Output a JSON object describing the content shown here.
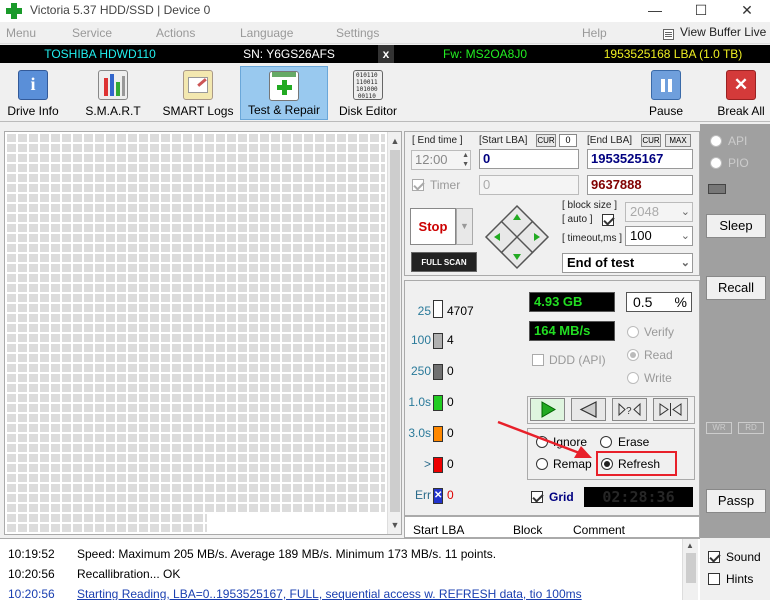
{
  "window": {
    "title": "Victoria 5.37 HDD/SSD | Device 0",
    "minimize": "—",
    "maximize": "☐",
    "close": "✕"
  },
  "menu": {
    "items": [
      "Menu",
      "Service",
      "Actions",
      "Language",
      "Settings",
      "Help"
    ],
    "view_buffer_live": "View Buffer Live"
  },
  "drive": {
    "model": "TOSHIBA HDWD110",
    "serial": "SN: Y6GS26AFS",
    "close": "x",
    "firmware": "Fw: MS2OA8J0",
    "lba": "1953525168 LBA (1.0 TB)"
  },
  "toolbar": {
    "drive_info": "Drive Info",
    "smart": "S.M.A.R.T",
    "smart_logs": "SMART Logs",
    "test_repair": "Test & Repair",
    "disk_editor": "Disk Editor",
    "pause": "Pause",
    "break_all": "Break All",
    "disk_editor_bits": "010110\n110011\n101000\n00110"
  },
  "test": {
    "end_time_label": "[ End time ]",
    "end_time_value": "12:00",
    "start_lba_label": "[Start LBA]",
    "cur_label": "CUR",
    "start_cur_value": "0",
    "start_lba_value": "0",
    "end_lba_label": "[End LBA]",
    "max_label": "MAX",
    "end_lba_value": "1953525167",
    "timer_label": "Timer",
    "timer_value": "0",
    "current_lba_value": "9637888",
    "block_size_label": "[ block size ]",
    "auto_label": "[ auto ]",
    "block_size_value": "2048",
    "timeout_label": "[ timeout,ms ]",
    "timeout_value": "100",
    "stop_label": "Stop",
    "full_scan_label": "FULL SCAN",
    "end_of_test_value": "End of test"
  },
  "stats": {
    "legend": [
      {
        "label": "25",
        "count": "4707",
        "color": "#ffffff"
      },
      {
        "label": "100",
        "count": "4",
        "color": "#b0b0b0"
      },
      {
        "label": "250",
        "count": "0",
        "color": "#707070"
      },
      {
        "label": "1.0s",
        "count": "0",
        "color": "#22cc22"
      },
      {
        "label": "3.0s",
        "count": "0",
        "color": "#ff8800"
      },
      {
        "label": ">",
        "count": "0",
        "color": "#ee0000"
      },
      {
        "label": "Err",
        "count": "0",
        "color": "#2233cc"
      }
    ],
    "size_readout": "4.93 GB",
    "percent_readout": "0.5",
    "percent_sign": "%",
    "speed_readout": "164 MB/s",
    "verify_label": "Verify",
    "read_label": "Read",
    "write_label": "Write",
    "ddd_label": "DDD (API)",
    "ignore_label": "Ignore",
    "erase_label": "Erase",
    "remap_label": "Remap",
    "refresh_label": "Refresh",
    "grid_label": "Grid",
    "grid_time": "02:28:36"
  },
  "table": {
    "col_start_lba": "Start LBA",
    "col_block": "Block",
    "col_comment": "Comment"
  },
  "side": {
    "api_label": "API",
    "pio_label": "PIO",
    "sleep_label": "Sleep",
    "recall_label": "Recall",
    "wr_label": "WR",
    "rd_label": "RD",
    "passp_label": "Passp",
    "sound_label": "Sound",
    "hints_label": "Hints"
  },
  "log": [
    {
      "time": "10:19:52",
      "text": "Speed: Maximum 205 MB/s. Average 189 MB/s. Minimum 173 MB/s. 11 points.",
      "color": "#000000"
    },
    {
      "time": "10:20:56",
      "text": "Recallibration... OK",
      "color": "#000000"
    },
    {
      "time": "10:20:56",
      "text": "Starting Reading, LBA=0..1953525167, FULL, sequential access w. REFRESH data, tio 100ms",
      "color": "#1a3fb0"
    }
  ],
  "colors": {
    "accent_annotation": "#e8202a",
    "tab_selected": "#99c9ef"
  }
}
